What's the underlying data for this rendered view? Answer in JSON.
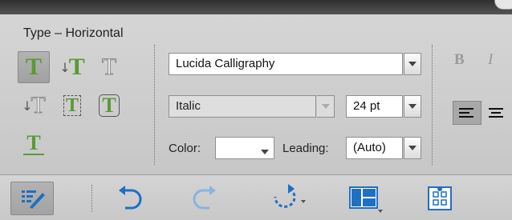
{
  "panel": {
    "title": "Type – Horizontal",
    "font_family": "Lucida Calligraphy",
    "font_style": "Italic",
    "font_size": "24 pt",
    "color_label": "Color:",
    "leading_label": "Leading:",
    "leading_value": "(Auto)",
    "bold_label": "B",
    "italic_label": "I",
    "type_glyph": "T"
  },
  "tools": [
    {
      "name": "horizontal-type",
      "selected": true
    },
    {
      "name": "vertical-type",
      "selected": false
    },
    {
      "name": "horizontal-type-mask",
      "selected": false
    },
    {
      "name": "vertical-type-mask",
      "selected": false
    },
    {
      "name": "text-on-selection",
      "selected": false
    },
    {
      "name": "text-on-shape",
      "selected": false
    },
    {
      "name": "text-on-path",
      "selected": false
    }
  ],
  "toolbar": {
    "icons": [
      "tool-options-icon",
      "undo-icon",
      "redo-icon",
      "rotate-icon",
      "layout-icon",
      "organizer-icon"
    ]
  },
  "colors": {
    "accent_green": "#5a9a36",
    "undo_blue": "#1f6fc4"
  }
}
